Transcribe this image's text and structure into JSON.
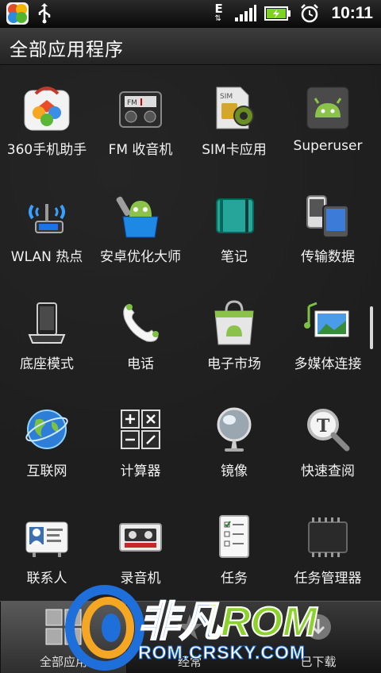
{
  "status_bar": {
    "time": "10:11",
    "icons": [
      "app-notification-icon",
      "usb-icon",
      "edge-data-icon",
      "signal-icon",
      "battery-charging-icon",
      "alarm-icon"
    ],
    "network_label": "E"
  },
  "header": {
    "title": "全部应用程序"
  },
  "apps": [
    {
      "label": "360手机助手",
      "icon": "360-assistant-icon"
    },
    {
      "label": "FM 收音机",
      "icon": "fm-radio-icon"
    },
    {
      "label": "SIM卡应用",
      "icon": "sim-card-icon"
    },
    {
      "label": "Superuser",
      "icon": "superuser-android-icon"
    },
    {
      "label": "WLAN 热点",
      "icon": "wlan-hotspot-icon"
    },
    {
      "label": "安卓优化大师",
      "icon": "android-optimizer-icon"
    },
    {
      "label": "笔记",
      "icon": "notebook-icon"
    },
    {
      "label": "传输数据",
      "icon": "transfer-data-icon"
    },
    {
      "label": "底座模式",
      "icon": "dock-mode-icon"
    },
    {
      "label": "电话",
      "icon": "phone-icon"
    },
    {
      "label": "电子市场",
      "icon": "android-market-icon"
    },
    {
      "label": "多媒体连接",
      "icon": "media-connect-icon"
    },
    {
      "label": "互联网",
      "icon": "internet-globe-icon"
    },
    {
      "label": "计算器",
      "icon": "calculator-icon"
    },
    {
      "label": "镜像",
      "icon": "mirror-icon"
    },
    {
      "label": "快速查阅",
      "icon": "quick-lookup-icon"
    },
    {
      "label": "联系人",
      "icon": "contacts-icon"
    },
    {
      "label": "录音机",
      "icon": "voice-recorder-icon"
    },
    {
      "label": "任务",
      "icon": "tasks-icon"
    },
    {
      "label": "任务管理器",
      "icon": "task-manager-icon"
    }
  ],
  "tabs": [
    {
      "label": "全部应用",
      "icon": "all-apps-grid-icon",
      "selected": true
    },
    {
      "label": "经常",
      "icon": "frequent-icon",
      "selected": false
    },
    {
      "label": "已下载",
      "icon": "downloaded-icon",
      "selected": false
    }
  ],
  "watermark": {
    "brand": "非凡ROM",
    "url": "ROM.CRSKY.COM"
  },
  "colors": {
    "background": "#1d1d1d",
    "accent_green": "#8bd22a",
    "watermark_blue": "#1e6fd9"
  }
}
